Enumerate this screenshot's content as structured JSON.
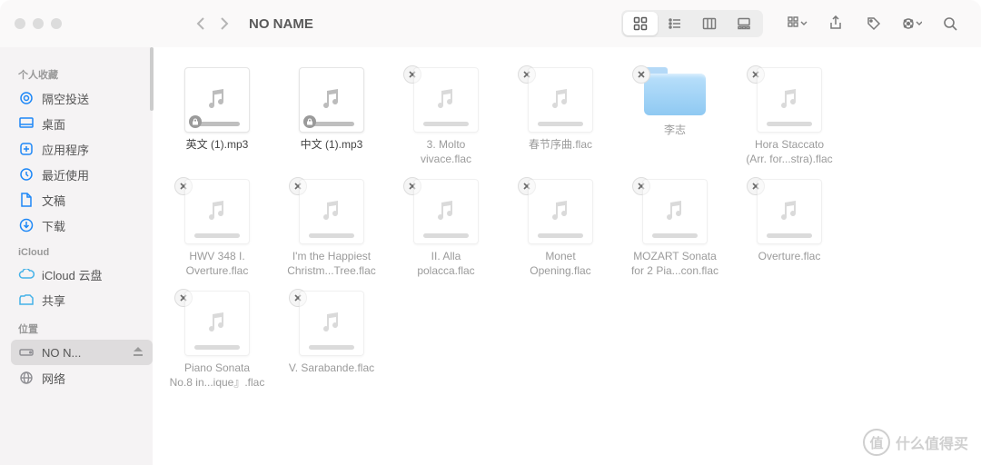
{
  "window": {
    "title": "NO NAME"
  },
  "sidebar": {
    "favorites_header": "个人收藏",
    "icloud_header": "iCloud",
    "locations_header": "位置",
    "items": [
      {
        "label": "隔空投送"
      },
      {
        "label": "桌面"
      },
      {
        "label": "应用程序"
      },
      {
        "label": "最近使用"
      },
      {
        "label": "文稿"
      },
      {
        "label": "下载"
      }
    ],
    "icloud": [
      {
        "label": "iCloud 云盘"
      },
      {
        "label": "共享"
      }
    ],
    "locations": [
      {
        "label": "NO N..."
      },
      {
        "label": "网络"
      }
    ]
  },
  "files": [
    {
      "label": "英文 (1).mp3",
      "kind": "audio",
      "pending": false,
      "locked": true
    },
    {
      "label": "中文 (1).mp3",
      "kind": "audio",
      "pending": false,
      "locked": true
    },
    {
      "label": "3. Molto\nvivace.flac",
      "kind": "audio",
      "pending": true
    },
    {
      "label": "春节序曲.flac",
      "kind": "audio",
      "pending": true
    },
    {
      "label": "李志",
      "kind": "folder",
      "pending": true
    },
    {
      "label": "Hora Staccato\n(Arr. for...stra).flac",
      "kind": "audio",
      "pending": true
    },
    {
      "label": "",
      "kind": "spacer"
    },
    {
      "label": "HWV 348 I.\nOverture.flac",
      "kind": "audio",
      "pending": true
    },
    {
      "label": "I'm the Happiest\nChristm...Tree.flac",
      "kind": "audio",
      "pending": true
    },
    {
      "label": "II. Alla\npolacca.flac",
      "kind": "audio",
      "pending": true
    },
    {
      "label": "Monet\nOpening.flac",
      "kind": "audio",
      "pending": true
    },
    {
      "label": "MOZART Sonata\nfor 2 Pia...con.flac",
      "kind": "audio",
      "pending": true
    },
    {
      "label": "Overture.flac",
      "kind": "audio",
      "pending": true
    },
    {
      "label": "",
      "kind": "spacer"
    },
    {
      "label": "Piano Sonata\nNo.8 in...ique』.flac",
      "kind": "audio",
      "pending": true
    },
    {
      "label": "V. Sarabande.flac",
      "kind": "audio",
      "pending": true
    }
  ],
  "watermark": {
    "logo": "值",
    "text": "什么值得买"
  }
}
